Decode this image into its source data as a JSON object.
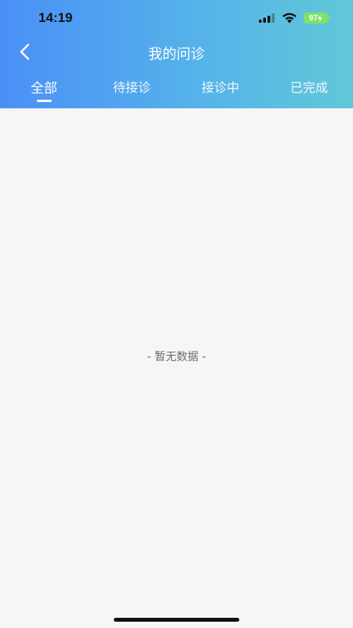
{
  "status_bar": {
    "time": "14:19",
    "battery": "97",
    "icons": [
      "signal-icon",
      "wifi-icon",
      "battery-charging-icon"
    ]
  },
  "nav": {
    "back_icon": "chevron-left-icon",
    "title": "我的问诊"
  },
  "tabs": [
    {
      "label": "全部",
      "active": true
    },
    {
      "label": "待接诊",
      "active": false
    },
    {
      "label": "接诊中",
      "active": false
    },
    {
      "label": "已完成",
      "active": false
    }
  ],
  "empty_state": {
    "text": "- 暂无数据 -"
  },
  "colors": {
    "header_gradient_start": "#4a8ff7",
    "header_gradient_end": "#62c8d8",
    "background": "#f6f6f6",
    "battery": "#7ee267"
  }
}
